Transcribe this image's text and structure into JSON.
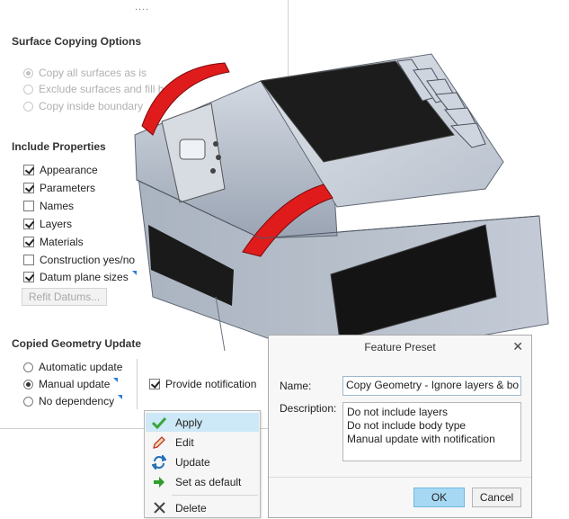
{
  "panel": {
    "grip": "....",
    "surface_copy": {
      "title": "Surface Copying Options",
      "options": [
        {
          "label": "Copy all surfaces as is",
          "selected": true
        },
        {
          "label": "Exclude surfaces and fill h",
          "selected": false
        },
        {
          "label": "Copy inside boundary",
          "selected": false
        }
      ]
    },
    "include": {
      "title": "Include Properties",
      "items": [
        {
          "label": "Appearance",
          "checked": true
        },
        {
          "label": "Parameters",
          "checked": true
        },
        {
          "label": "Names",
          "checked": false
        },
        {
          "label": "Layers",
          "checked": true
        },
        {
          "label": "Materials",
          "checked": true
        },
        {
          "label": "Construction yes/no",
          "checked": false
        },
        {
          "label": "Datum plane sizes",
          "checked": true
        }
      ],
      "refit_label": "Refit Datums..."
    },
    "update": {
      "title": "Copied Geometry Update",
      "options": [
        {
          "label": "Automatic update",
          "selected": false
        },
        {
          "label": "Manual update",
          "selected": true
        },
        {
          "label": "No dependency",
          "selected": false
        }
      ],
      "notification_label": "Provide notification",
      "notification_checked": true
    }
  },
  "menu": {
    "items": [
      {
        "label": "Apply",
        "icon": "checkmark-icon"
      },
      {
        "label": "Edit",
        "icon": "pencil-icon"
      },
      {
        "label": "Update",
        "icon": "refresh-icon"
      },
      {
        "label": "Set as default",
        "icon": "arrow-right-icon"
      },
      {
        "label": "Delete",
        "icon": "close-icon"
      }
    ]
  },
  "dialog": {
    "title": "Feature Preset",
    "name_label": "Name:",
    "name_value": "Copy Geometry - Ignore layers & bo",
    "desc_label": "Description:",
    "description": [
      "Do not include layers",
      "Do not include body type",
      "Manual update with notification"
    ],
    "ok_label": "OK",
    "cancel_label": "Cancel"
  },
  "colors": {
    "accent": "#2a7fd4",
    "highlight": "#cde8f6",
    "ok_button": "#a7d8f3",
    "model_body": "#b9c2cf",
    "model_red": "#e01b1b",
    "apply_green": "#3aa63a"
  }
}
